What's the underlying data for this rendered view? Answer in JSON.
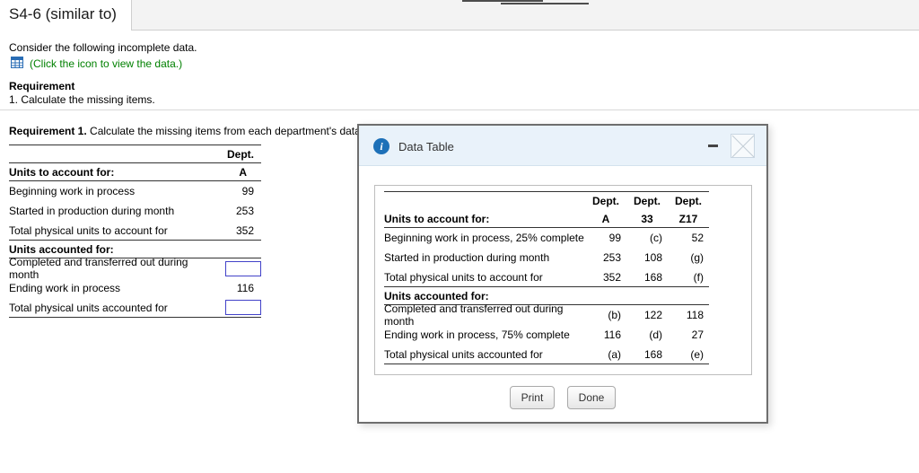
{
  "topbar": {
    "title": "S4-6 (similar to)"
  },
  "intro": {
    "line": "Consider the following incomplete data.",
    "icon_link": "(Click the icon to view the data.)",
    "requirement_heading": "Requirement",
    "requirement_item": "1. Calculate the missing items."
  },
  "worksheet": {
    "title_bold": "Requirement 1.",
    "title_rest": " Calculate the missing items from each department's data.",
    "dept_header": "Dept.",
    "dept_sub": "A",
    "section1": "Units to account for:",
    "rows1": [
      {
        "label": "Beginning work in process",
        "value": "99"
      },
      {
        "label": "Started in production during month",
        "value": "253"
      },
      {
        "label": "Total physical units to account for",
        "value": "352"
      }
    ],
    "section2": "Units accounted for:",
    "rows2": [
      {
        "label": "Completed and transferred out during month",
        "value": ""
      },
      {
        "label": "Ending work in process",
        "value": "116"
      },
      {
        "label": "Total physical units accounted for",
        "value": ""
      }
    ]
  },
  "modal": {
    "title": "Data Table",
    "info_icon": "i",
    "table": {
      "dept_header": "Dept.",
      "col_subs": [
        "A",
        "33",
        "Z17"
      ],
      "section1": "Units to account for:",
      "rows1": [
        {
          "label": "Beginning work in process, 25% complete",
          "values": [
            "99",
            "(c)",
            "52"
          ]
        },
        {
          "label": "Started in production during month",
          "values": [
            "253",
            "108",
            "(g)"
          ]
        },
        {
          "label": "Total physical units to account for",
          "values": [
            "352",
            "168",
            "(f)"
          ]
        }
      ],
      "section2": "Units accounted for:",
      "rows2": [
        {
          "label": "Completed and transferred out during month",
          "values": [
            "(b)",
            "122",
            "118"
          ]
        },
        {
          "label": "Ending work in process, 75% complete",
          "values": [
            "116",
            "(d)",
            "27"
          ]
        },
        {
          "label": "Total physical units accounted for",
          "values": [
            "(a)",
            "168",
            "(e)"
          ]
        }
      ]
    },
    "print_label": "Print",
    "done_label": "Done"
  },
  "colors": {
    "link_green": "#008000",
    "modal_header_bg": "#e9f2fa",
    "info_blue": "#1d70b8",
    "input_border": "#4242c8"
  }
}
